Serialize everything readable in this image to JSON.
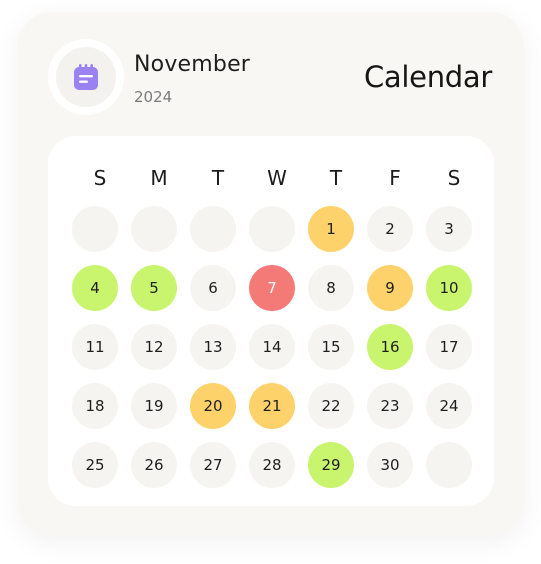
{
  "header": {
    "month": "November",
    "year": "2024",
    "title": "Calendar",
    "icon": "calendar-icon"
  },
  "colors": {
    "accent_purple": "#9b82f3",
    "green": "#c9f46e",
    "yellow": "#fdd26b",
    "red": "#f47a78"
  },
  "calendar": {
    "weekdays": [
      "S",
      "M",
      "T",
      "W",
      "T",
      "F",
      "S"
    ],
    "days": [
      {
        "label": "",
        "status": "empty"
      },
      {
        "label": "",
        "status": "empty"
      },
      {
        "label": "",
        "status": "empty"
      },
      {
        "label": "",
        "status": "empty"
      },
      {
        "label": "1",
        "status": "yellow"
      },
      {
        "label": "2",
        "status": "default"
      },
      {
        "label": "3",
        "status": "default"
      },
      {
        "label": "4",
        "status": "green"
      },
      {
        "label": "5",
        "status": "green"
      },
      {
        "label": "6",
        "status": "default"
      },
      {
        "label": "7",
        "status": "red"
      },
      {
        "label": "8",
        "status": "default"
      },
      {
        "label": "9",
        "status": "yellow"
      },
      {
        "label": "10",
        "status": "green"
      },
      {
        "label": "11",
        "status": "default"
      },
      {
        "label": "12",
        "status": "default"
      },
      {
        "label": "13",
        "status": "default"
      },
      {
        "label": "14",
        "status": "default"
      },
      {
        "label": "15",
        "status": "default"
      },
      {
        "label": "16",
        "status": "green"
      },
      {
        "label": "17",
        "status": "default"
      },
      {
        "label": "18",
        "status": "default"
      },
      {
        "label": "19",
        "status": "default"
      },
      {
        "label": "20",
        "status": "yellow"
      },
      {
        "label": "21",
        "status": "yellow"
      },
      {
        "label": "22",
        "status": "default"
      },
      {
        "label": "23",
        "status": "default"
      },
      {
        "label": "24",
        "status": "default"
      },
      {
        "label": "25",
        "status": "default"
      },
      {
        "label": "26",
        "status": "default"
      },
      {
        "label": "27",
        "status": "default"
      },
      {
        "label": "28",
        "status": "default"
      },
      {
        "label": "29",
        "status": "green"
      },
      {
        "label": "30",
        "status": "default"
      },
      {
        "label": "",
        "status": "empty"
      }
    ]
  }
}
